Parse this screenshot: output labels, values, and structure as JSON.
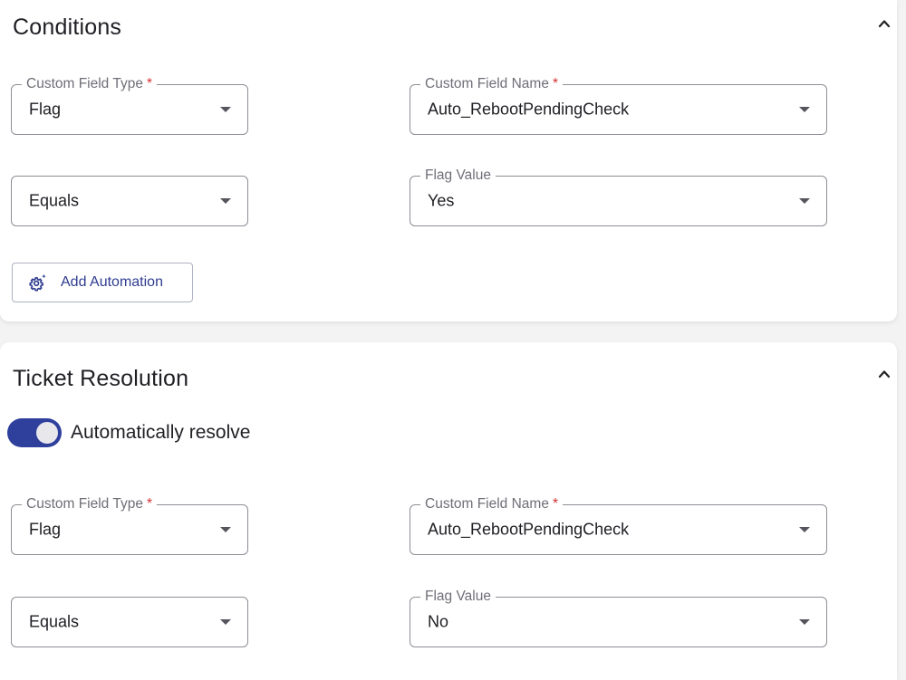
{
  "conditions": {
    "title": "Conditions",
    "custom_field_type": {
      "label": "Custom Field Type",
      "required_mark": "*",
      "value": "Flag"
    },
    "custom_field_name": {
      "label": "Custom Field Name",
      "required_mark": "*",
      "value": "Auto_RebootPendingCheck"
    },
    "operator": {
      "value": "Equals"
    },
    "flag_value": {
      "label": "Flag Value",
      "value": "Yes"
    },
    "add_automation_label": "Add Automation"
  },
  "resolution": {
    "title": "Ticket Resolution",
    "toggle": {
      "label": "Automatically resolve",
      "on": true
    },
    "custom_field_type": {
      "label": "Custom Field Type",
      "required_mark": "*",
      "value": "Flag"
    },
    "custom_field_name": {
      "label": "Custom Field Name",
      "required_mark": "*",
      "value": "Auto_RebootPendingCheck"
    },
    "operator": {
      "value": "Equals"
    },
    "flag_value": {
      "label": "Flag Value",
      "value": "No"
    }
  },
  "colors": {
    "accent": "#2e3f9c",
    "required": "#d63031",
    "button_text": "#2f3c8f"
  },
  "icons": {
    "collapse": "chevron-up-icon",
    "automation": "gear-sparkle-icon",
    "dropdown": "caret-down-icon"
  }
}
